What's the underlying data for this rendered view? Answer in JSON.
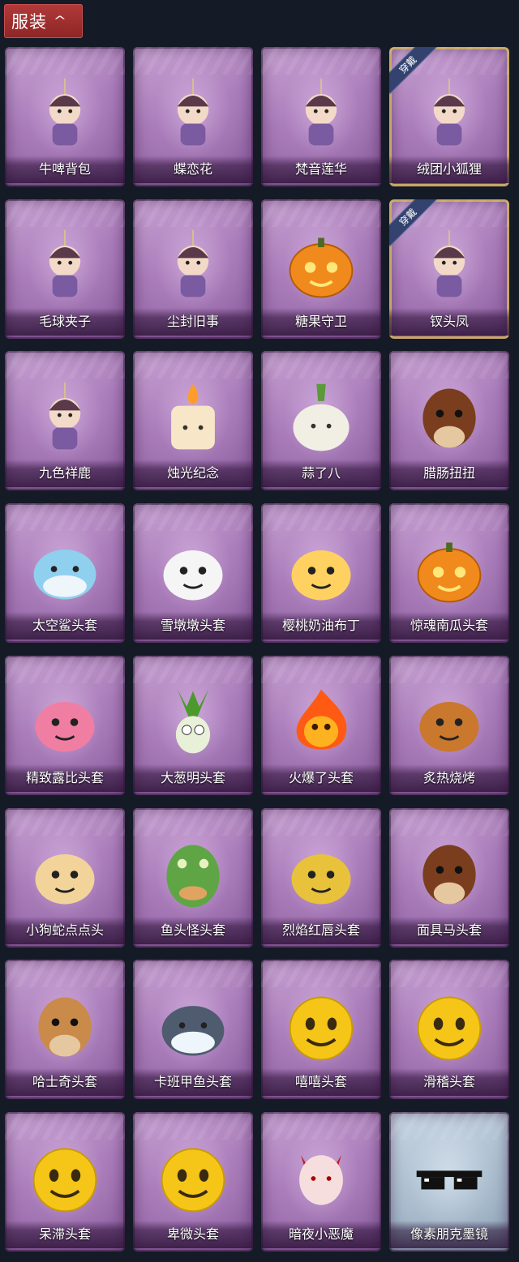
{
  "header": {
    "title": "服装",
    "toggle_icon": "chevron-up-icon"
  },
  "equipped_label": "穿戴",
  "items": [
    {
      "label": "牛啤背包",
      "icon": "cow-beer-mug-icon",
      "equipped": false,
      "style": "purple"
    },
    {
      "label": "蝶恋花",
      "icon": "bell-wreath-icon",
      "equipped": false,
      "style": "purple"
    },
    {
      "label": "梵音莲华",
      "icon": "pink-hair-doll-icon",
      "equipped": false,
      "style": "purple"
    },
    {
      "label": "绒团小狐狸",
      "icon": "fox-charm-icon",
      "equipped": true,
      "style": "purple"
    },
    {
      "label": "毛球夹子",
      "icon": "raccoon-drummer-icon",
      "equipped": false,
      "style": "purple"
    },
    {
      "label": "尘封旧事",
      "icon": "dark-hair-doll-icon",
      "equipped": false,
      "style": "purple"
    },
    {
      "label": "糖果守卫",
      "icon": "pumpkin-scarecrow-icon",
      "equipped": false,
      "style": "purple"
    },
    {
      "label": "钗头凤",
      "icon": "phoenix-crown-doll-icon",
      "equipped": true,
      "style": "purple"
    },
    {
      "label": "九色祥鹿",
      "icon": "deer-charm-icon",
      "equipped": false,
      "style": "purple"
    },
    {
      "label": "烛光纪念",
      "icon": "candle-icon",
      "equipped": false,
      "style": "purple"
    },
    {
      "label": "蒜了八",
      "icon": "garlic-icon",
      "equipped": false,
      "style": "purple"
    },
    {
      "label": "腊肠扭扭",
      "icon": "dachshund-icon",
      "equipped": false,
      "style": "purple"
    },
    {
      "label": "太空鲨头套",
      "icon": "shark-head-icon",
      "equipped": false,
      "style": "purple"
    },
    {
      "label": "雪墩墩头套",
      "icon": "snowman-head-icon",
      "equipped": false,
      "style": "purple"
    },
    {
      "label": "樱桃奶油布丁",
      "icon": "pudding-icon",
      "equipped": false,
      "style": "purple"
    },
    {
      "label": "惊魂南瓜头套",
      "icon": "pumpkin-head-icon",
      "equipped": false,
      "style": "purple"
    },
    {
      "label": "精致露比头套",
      "icon": "pink-beaver-head-icon",
      "equipped": false,
      "style": "purple"
    },
    {
      "label": "大葱明头套",
      "icon": "scallion-head-icon",
      "equipped": false,
      "style": "purple"
    },
    {
      "label": "火爆了头套",
      "icon": "fire-head-icon",
      "equipped": false,
      "style": "purple"
    },
    {
      "label": "炙热烧烤",
      "icon": "grilled-meat-icon",
      "equipped": false,
      "style": "purple"
    },
    {
      "label": "小狗蛇点点头",
      "icon": "snake-head-icon",
      "equipped": false,
      "style": "purple"
    },
    {
      "label": "鱼头怪头套",
      "icon": "fish-head-icon",
      "equipped": false,
      "style": "purple"
    },
    {
      "label": "烈焰红唇头套",
      "icon": "yellow-mask-sunglasses-icon",
      "equipped": false,
      "style": "purple"
    },
    {
      "label": "面具马头套",
      "icon": "horse-head-icon",
      "equipped": false,
      "style": "purple"
    },
    {
      "label": "哈士奇头套",
      "icon": "husky-head-icon",
      "equipped": false,
      "style": "purple"
    },
    {
      "label": "卡班甲鱼头套",
      "icon": "turtle-head-icon",
      "equipped": false,
      "style": "purple"
    },
    {
      "label": "嘻嘻头套",
      "icon": "grin-emoji-icon",
      "equipped": false,
      "style": "purple"
    },
    {
      "label": "滑稽头套",
      "icon": "funny-emoji-icon",
      "equipped": false,
      "style": "purple"
    },
    {
      "label": "呆滞头套",
      "icon": "flushed-emoji-icon",
      "equipped": false,
      "style": "purple"
    },
    {
      "label": "卑微头套",
      "icon": "pleading-emoji-icon",
      "equipped": false,
      "style": "purple"
    },
    {
      "label": "暗夜小恶魔",
      "icon": "devil-head-icon",
      "equipped": false,
      "style": "purple"
    },
    {
      "label": "像素朋克墨镜",
      "icon": "pixel-sunglasses-icon",
      "equipped": false,
      "style": "silver"
    }
  ],
  "colors": {
    "background": "#141b26",
    "header": "#a02f2f",
    "card": "#a779b7",
    "equipped_border": "#c9a865",
    "badge": "#33426e"
  }
}
